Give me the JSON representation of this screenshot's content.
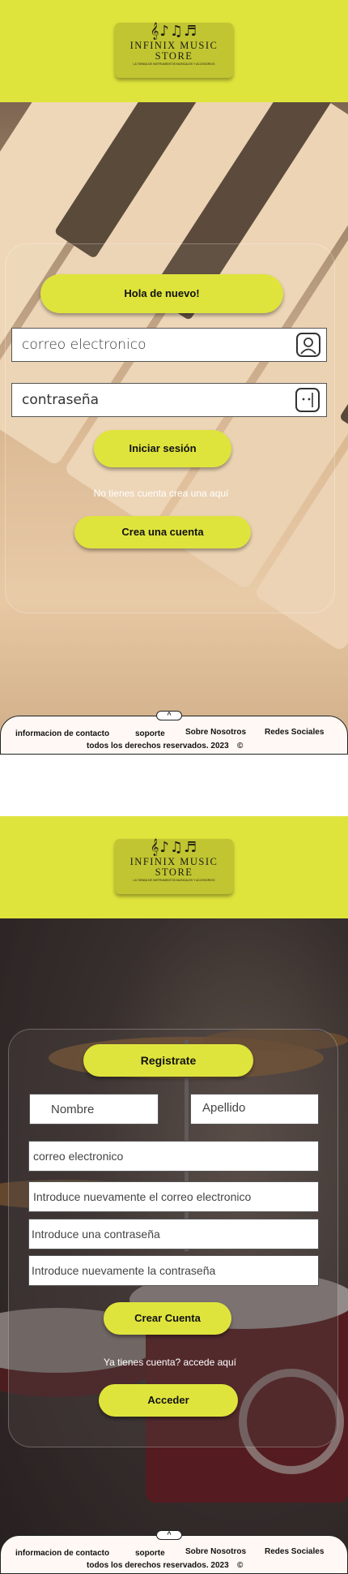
{
  "brand": {
    "notes": "𝄞♪♫♬",
    "name_line1": "INFINIX MUSIC",
    "name_line2": "STORE",
    "tagline": "LA TIENDA DE INSTRUMENTOS MUSICALES Y ACCESORIOS"
  },
  "login": {
    "greeting": "Hola de nuevo!",
    "email_placeholder": "correo electronico",
    "password_placeholder": "contraseña",
    "submit_label": "Iniciar sesión",
    "no_account_text": "No tienes cuenta crea una aquí",
    "create_account_label": "Crea una cuenta"
  },
  "register": {
    "title": "Registrate",
    "first_name_placeholder": "Nombre",
    "last_name_placeholder": "Apellido",
    "email_placeholder": "correo electronico",
    "email_confirm_placeholder": "Introduce nuevamente el correo electronico",
    "password_placeholder": "Introduce una contraseña",
    "password_confirm_placeholder": "Introduce nuevamente la contraseña",
    "submit_label": "Crear Cuenta",
    "have_account_text": "Ya tienes cuenta? accede aquí",
    "login_label": "Acceder"
  },
  "footer": {
    "toggle_glyph": "^",
    "contact": "informacion de contacto",
    "support": "soporte",
    "about": "Sobre Nosotros",
    "social": "Redes Sociales",
    "rights": "todos los derechos reservados.  2023",
    "copyright_symbol": "©"
  },
  "colors": {
    "accent": "#dfe43c",
    "logo_bg": "#c1c532",
    "footer_bg": "#fff8f4"
  }
}
